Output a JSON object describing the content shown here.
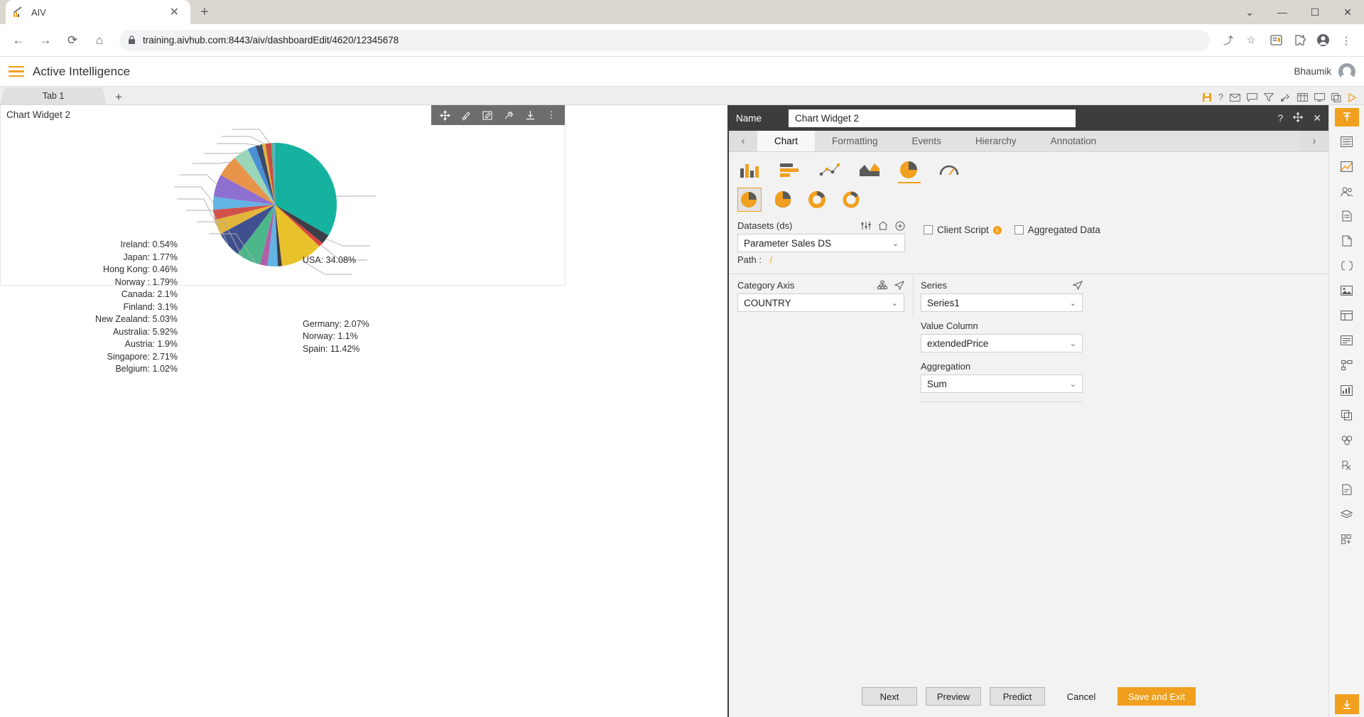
{
  "browser": {
    "tab_title": "AIV",
    "tab_close": "✕",
    "new_tab": "+",
    "url": "training.aivhub.com:8443/aiv/dashboardEdit/4620/12345678",
    "back": "←",
    "forward": "→",
    "reload": "⟳",
    "home": "⌂",
    "lock_icon": "🔒",
    "window_minimize": "—",
    "window_maximize": "☐",
    "window_close": "✕",
    "window_chevron": "⌄",
    "omni_share": "⤴",
    "omni_star": "☆",
    "ext_collections": "▤",
    "ext_puzzle": "❖",
    "ext_profile": "●",
    "ext_menu": "⋮"
  },
  "app": {
    "title": "Active Intelligence",
    "user": "Bhaumik"
  },
  "dashboard_tabs": {
    "tab1": "Tab 1",
    "add": "+",
    "toolbar_icons": [
      "save-icon",
      "help-icon",
      "mail-icon",
      "comment-icon",
      "filter-icon",
      "tools-icon",
      "table-icon",
      "presentation-icon",
      "copy-icon",
      "play-icon"
    ]
  },
  "widget": {
    "title": "Chart Widget 2",
    "toolbar": [
      "move-icon",
      "pen-icon",
      "edit-icon",
      "settings-icon",
      "download-icon",
      "more-icon"
    ]
  },
  "chart_data": {
    "type": "pie",
    "title": "Chart Widget 2",
    "xlabel": "",
    "ylabel": "",
    "legend_position": "labels-with-leader-lines",
    "categories": [
      "USA",
      "Germany",
      "Norway",
      "Spain",
      "Belgium",
      "Singapore",
      "Austria",
      "Australia",
      "New Zealand",
      "Finland",
      "Canada",
      "Norway ",
      "Hong Kong",
      "Japan",
      "Ireland"
    ],
    "values": [
      34.08,
      2.07,
      1.1,
      11.42,
      1.02,
      2.71,
      1.9,
      5.92,
      5.03,
      3.1,
      2.1,
      1.79,
      0.46,
      1.77,
      0.54
    ],
    "unit": "%",
    "labels_left": [
      "Ireland: 0.54%",
      "Japan: 1.77%",
      "Hong Kong: 0.46%",
      "Norway : 1.79%",
      "Canada: 2.1%",
      "Finland: 3.1%",
      "New Zealand: 5.03%",
      "Australia: 5.92%",
      "Austria: 1.9%",
      "Singapore: 2.71%",
      "Belgium: 1.02%"
    ],
    "labels_right": [
      "USA: 34.08%",
      "Germany: 2.07%",
      "Norway: 1.1%",
      "Spain: 11.42%"
    ],
    "colors": [
      "#16b2a0",
      "#e8c22a",
      "#3e3e48",
      "#d9453f",
      "#79c9d4",
      "#b05fa8",
      "#4cb88a",
      "#3f4f8f",
      "#e2b53b",
      "#d0514c",
      "#63b3e4",
      "#8f6fd0",
      "#e8934a",
      "#9ad7b8",
      "#4a8fd4",
      "#3b4a6b",
      "#c94f44"
    ]
  },
  "props": {
    "name_label": "Name",
    "name_value": "Chart Widget 2",
    "header_icons": [
      "help-icon",
      "move-icon",
      "close-icon"
    ],
    "tabs": [
      "Chart",
      "Formatting",
      "Events",
      "Hierarchy",
      "Annotation"
    ],
    "active_tab": "Chart",
    "prev_arrow": "‹",
    "next_arrow": "›",
    "chart_types": [
      "column-chart-icon",
      "bar-chart-icon",
      "scatter-chart-icon",
      "area-chart-icon",
      "pie-chart-icon",
      "gauge-chart-icon"
    ],
    "selected_chart_type": "pie-chart-icon",
    "chart_subtypes": [
      "pie-plain-icon",
      "pie-3d-icon",
      "donut-icon",
      "donut-thin-icon"
    ],
    "selected_subtype": "pie-plain-icon",
    "datasets_label": "Datasets (ds)",
    "datasets_value": "Parameter Sales DS",
    "datasets_icons": [
      "sliders-icon",
      "home-icon",
      "plus-circle-icon"
    ],
    "path_label": "Path :",
    "path_value": "/",
    "client_script_label": "Client Script",
    "aggregated_data_label": "Aggregated Data",
    "info_icon": "i",
    "category_axis_label": "Category Axis",
    "category_axis_icons": [
      "hierarchy-icon",
      "send-icon"
    ],
    "category_axis_value": "COUNTRY",
    "series_label": "Series",
    "series_icon": "send-icon",
    "series_value": "Series1",
    "value_column_label": "Value Column",
    "value_column_value": "extendedPrice",
    "aggregation_label": "Aggregation",
    "aggregation_value": "Sum",
    "chevron": "⌄",
    "buttons": {
      "next": "Next",
      "preview": "Preview",
      "predict": "Predict",
      "cancel": "Cancel",
      "save_exit": "Save and Exit"
    }
  },
  "rail": {
    "items": [
      "pin-icon",
      "list-icon",
      "chart-bar-icon",
      "users-icon",
      "document-icon",
      "page-icon",
      "code-icon",
      "image-icon",
      "dashboard-icon",
      "form-icon",
      "tree-icon",
      "analytics-icon",
      "copy-icon",
      "layers-icon",
      "rx-icon",
      "file-icon",
      "stack-icon",
      "grid-plus-icon"
    ],
    "top_action": "pin-up-icon",
    "bottom_action": "download-icon"
  }
}
